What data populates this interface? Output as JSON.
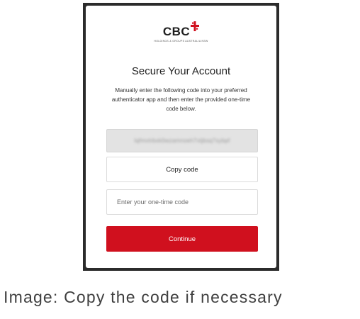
{
  "logo": {
    "text": "CBC",
    "subtitle": "HOLDINGS & GROUPS AUSTRALIA NSW",
    "mark_color": "#d0101e"
  },
  "title": "Secure Your Account",
  "description": "Manually enter the following code into your preferred authenticator app and then enter the provided one-time code below.",
  "secret_code": "lqfmvtrbxk0wzamnoeh7vtjbsq7sybpf",
  "copy_button": {
    "label": "Copy code"
  },
  "otp_input": {
    "placeholder": "Enter your one-time code",
    "value": ""
  },
  "continue_button": {
    "label": "Continue",
    "color": "#d0101e"
  },
  "caption": "Image: Copy the code if necessary"
}
